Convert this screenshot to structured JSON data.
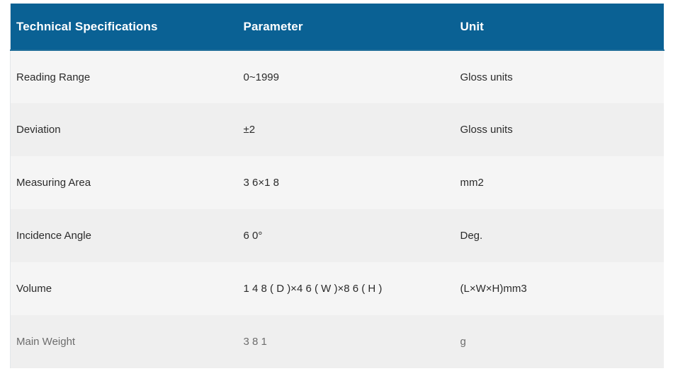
{
  "table": {
    "title": "Technical Specifications",
    "header_background": "#0a6194",
    "header_text_color": "#ffffff",
    "row_background_odd": "#f5f5f5",
    "row_background_even": "#efefef",
    "columns": [
      {
        "key": "spec",
        "label": "Technical Specifications"
      },
      {
        "key": "parameter",
        "label": "Parameter"
      },
      {
        "key": "unit",
        "label": "Unit"
      }
    ],
    "rows": [
      {
        "spec": "Reading Range",
        "parameter": "0~1999",
        "unit": "Gloss units"
      },
      {
        "spec": "Deviation",
        "parameter": "±2",
        "unit": "Gloss units"
      },
      {
        "spec": "Measuring Area",
        "parameter": "3 6×1 8",
        "unit": "mm2"
      },
      {
        "spec": "Incidence Angle",
        "parameter": "6 0°",
        "unit": "Deg."
      },
      {
        "spec": "Volume",
        "parameter": "1 4 8 ( D )×4 6 ( W )×8 6 ( H )",
        "unit": "(L×W×H)mm3"
      },
      {
        "spec": "Main Weight",
        "parameter": "3 8 1",
        "unit": "g"
      }
    ]
  }
}
